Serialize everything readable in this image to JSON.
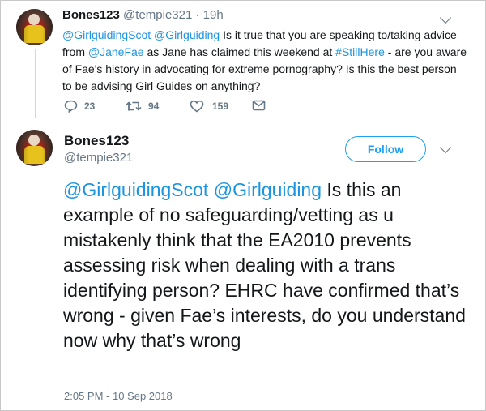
{
  "reply_tweet": {
    "author_name": "Bones123",
    "author_handle": "@tempie321",
    "separator": "·",
    "time_ago": "19h",
    "mention_1": "@GirlguidingScot",
    "mention_2": "@Girlguiding",
    "text_part_1": " Is it true that you are speaking to/taking advice from ",
    "mention_3": "@JaneFae",
    "text_part_2": "  as Jane has claimed this weekend at ",
    "hashtag": "#StillHere",
    "text_part_3": "  - are you aware of Fae's history in advocating for extreme pornography? Is this the best person to be advising Girl Guides on anything?",
    "reply_count": "23",
    "retweet_count": "94",
    "like_count": "159",
    "icons": [
      "reply-icon",
      "retweet-icon",
      "like-icon",
      "direct-message-icon",
      "chevron-down-icon"
    ]
  },
  "main_tweet": {
    "author_name": "Bones123",
    "author_handle": "@tempie321",
    "follow_label": "Follow",
    "mention_1": "@GirlguidingScot",
    "mention_2": "@Girlguiding",
    "text": " Is this an example of no safeguarding/vetting as u mistakenly think that the EA2010 prevents assessing risk when dealing with a trans identifying person? EHRC have confirmed that’s wrong - given Fae’s interests, do you understand now why that’s wrong",
    "timestamp": "2:05 PM - 10 Sep 2018"
  },
  "colors": {
    "link": "#1b95e0",
    "follow": "#1da1f2",
    "muted": "#657786",
    "text": "#14171a"
  }
}
